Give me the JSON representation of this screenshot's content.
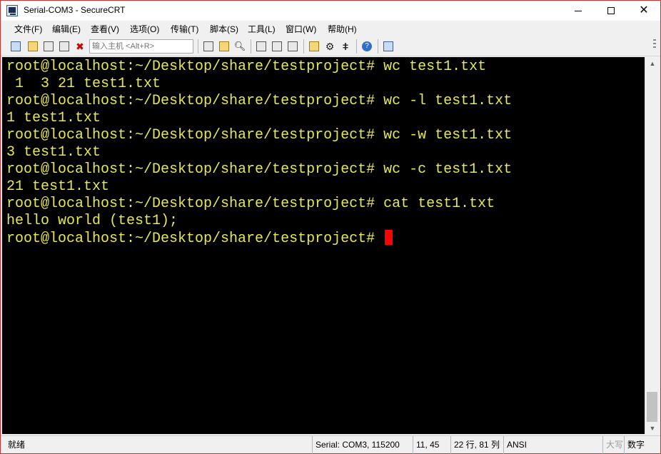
{
  "window": {
    "title": "Serial-COM3 - SecureCRT",
    "accent_color": "#c83232"
  },
  "menu": {
    "items": [
      "文件(F)",
      "编辑(E)",
      "查看(V)",
      "选项(O)",
      "传输(T)",
      "脚本(S)",
      "工具(L)",
      "窗口(W)",
      "帮助(H)"
    ]
  },
  "toolbar": {
    "quick_connect_placeholder": "输入主机 <Alt+R>",
    "icons": [
      "connect-icon",
      "quick-connect-icon",
      "connect-in-tab-icon",
      "reconnect-icon",
      "disconnect-icon",
      "copy-icon",
      "paste-icon",
      "find-icon",
      "print-setup-icon",
      "print-screen-icon",
      "print-icon",
      "session-options-icon",
      "global-options-icon",
      "keymap-icon",
      "help-icon",
      "sftp-icon"
    ]
  },
  "terminal": {
    "text_color": "#e8e84a",
    "cursor_color": "#ff0000",
    "lines": [
      "root@localhost:~/Desktop/share/testproject# wc test1.txt",
      " 1  3 21 test1.txt",
      "root@localhost:~/Desktop/share/testproject# wc -l test1.txt",
      "1 test1.txt",
      "root@localhost:~/Desktop/share/testproject# wc -w test1.txt",
      "3 test1.txt",
      "root@localhost:~/Desktop/share/testproject# wc -c test1.txt",
      "21 test1.txt",
      "root@localhost:~/Desktop/share/testproject# cat test1.txt",
      "hello world (test1);",
      "root@localhost:~/Desktop/share/testproject# "
    ]
  },
  "status": {
    "ready": "就绪",
    "serial": "Serial: COM3, 115200",
    "cursor_pos": "11,  45",
    "size": "22 行, 81 列",
    "encoding": "ANSI",
    "caps": "大写",
    "num": "数字"
  }
}
